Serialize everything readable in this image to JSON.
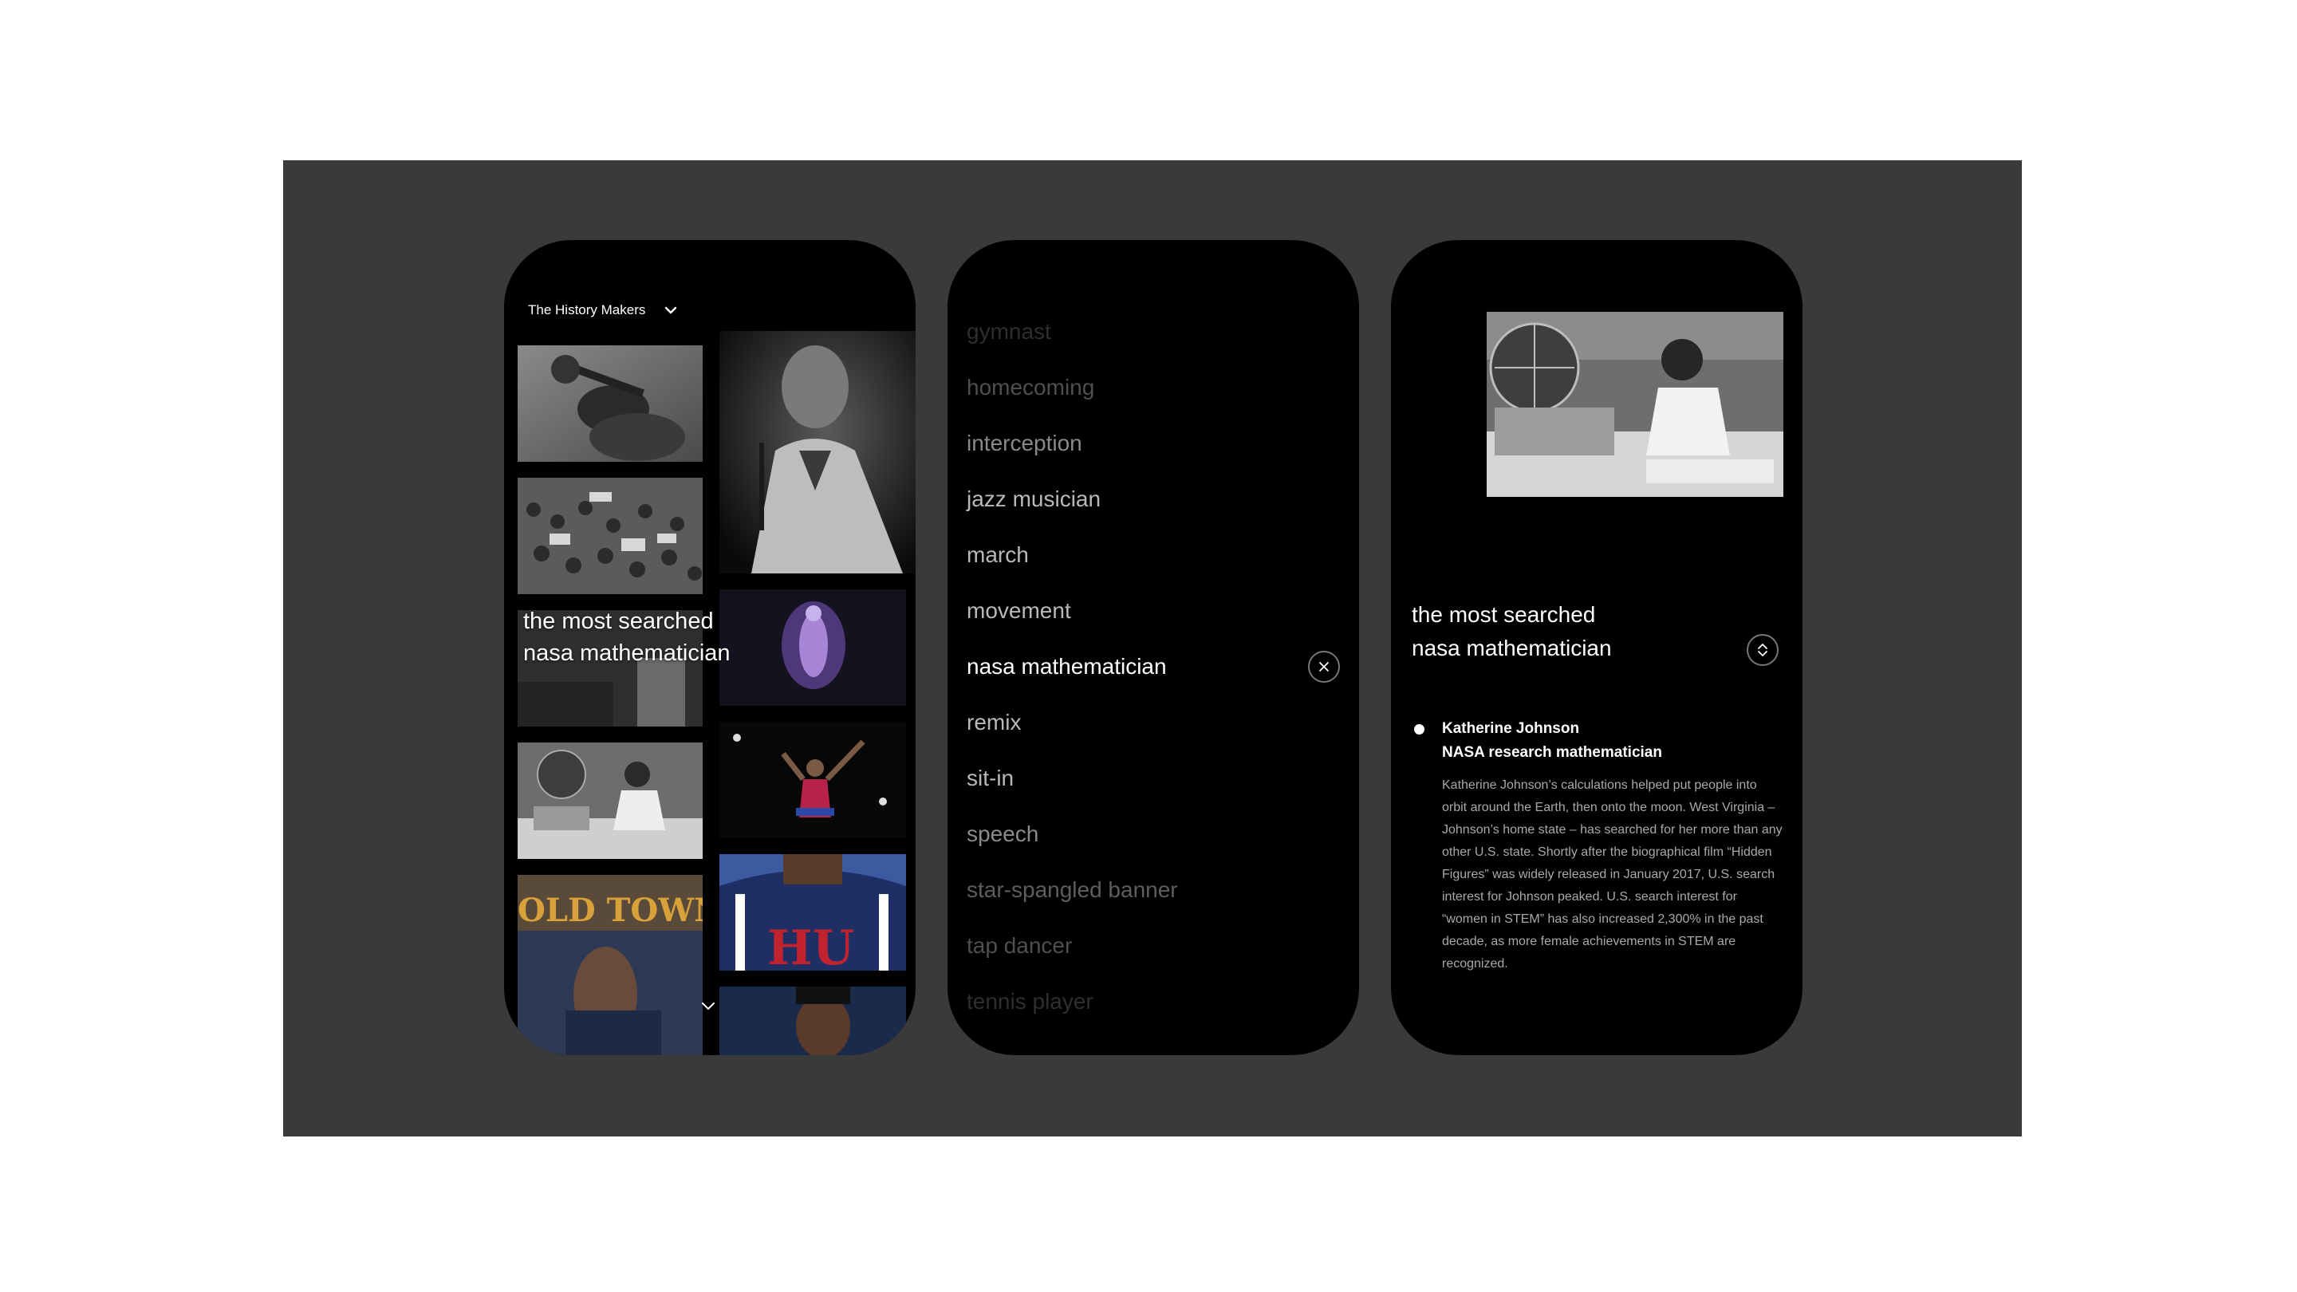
{
  "phone1": {
    "collection_title": "The History Makers",
    "overlay_line1": "the most searched",
    "overlay_line2": "nasa mathematician",
    "sign_text": "OLD TOWN",
    "jersey_text": "HU"
  },
  "phone2": {
    "items": [
      {
        "label": "gymnast"
      },
      {
        "label": "homecoming"
      },
      {
        "label": "interception"
      },
      {
        "label": "jazz musician"
      },
      {
        "label": "march"
      },
      {
        "label": "movement"
      },
      {
        "label": "nasa mathematician"
      },
      {
        "label": "remix"
      },
      {
        "label": "sit-in"
      },
      {
        "label": "speech"
      },
      {
        "label": "star-spangled banner"
      },
      {
        "label": "tap dancer"
      },
      {
        "label": "tennis player"
      }
    ],
    "selected": "nasa mathematician"
  },
  "phone3": {
    "title_line1": "the most searched",
    "title_line2": "nasa mathematician",
    "person_name": "Katherine Johnson",
    "person_role": "NASA research mathematician",
    "description": "Katherine Johnson’s calculations helped put people into orbit around the Earth, then onto the moon. West Virginia – Johnson’s home state – has searched for her more than any other U.S. state. Shortly after the biographical film “Hidden Figures” was widely released in January 2017, U.S. search interest for Johnson peaked. U.S. search interest for “women in STEM” has also increased 2,300% in the past decade, as more female achievements in STEM are recognized."
  },
  "icons": {
    "dropdown": "chevron-down-icon",
    "scroll": "chevron-down-icon",
    "clear": "close-icon",
    "sort": "unfold-icon"
  }
}
